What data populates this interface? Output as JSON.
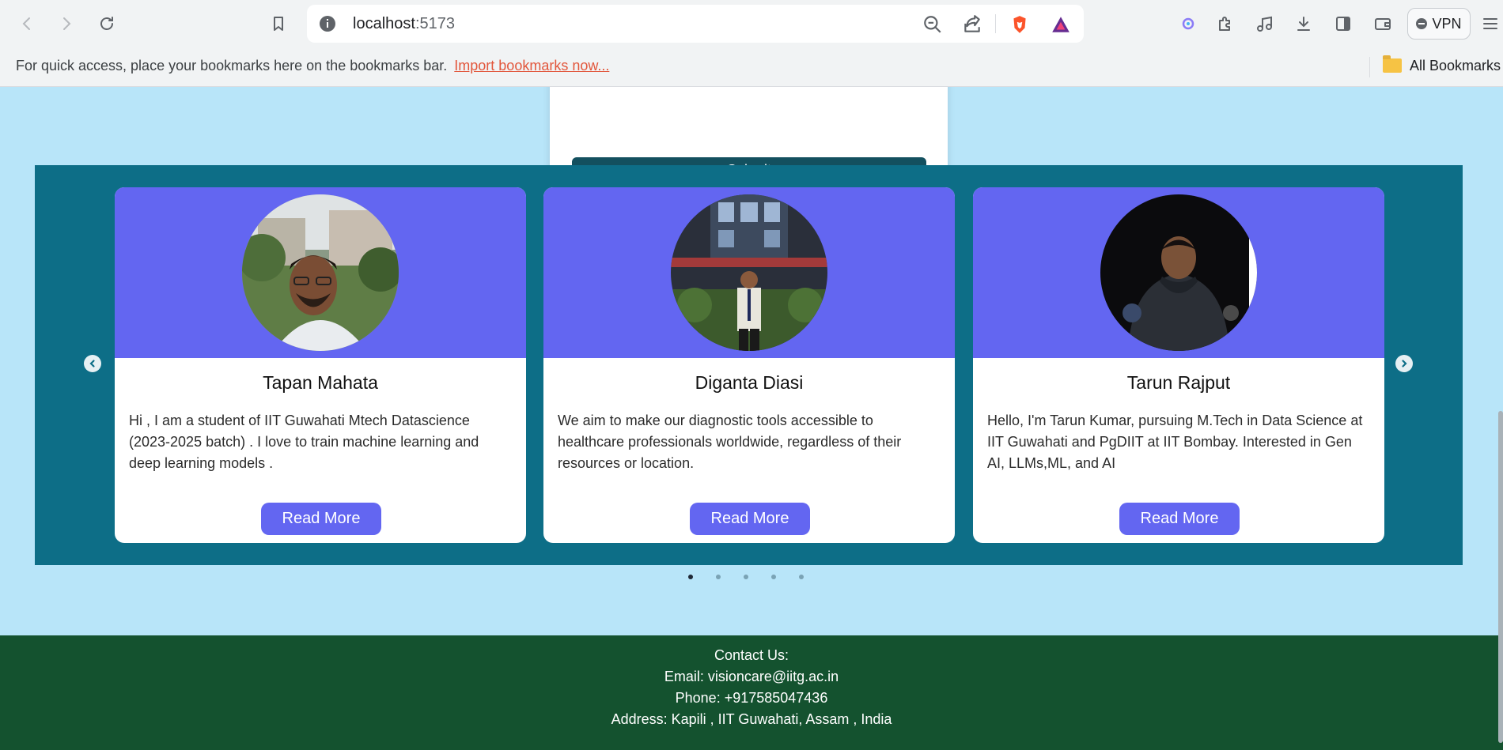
{
  "browser": {
    "url_host": "localhost",
    "url_port": ":5173",
    "vpn_label": "VPN",
    "bookmarks_hint": "For quick access, place your bookmarks here on the bookmarks bar.",
    "bookmarks_import": "Import bookmarks now...",
    "all_bookmarks": "All Bookmarks"
  },
  "form": {
    "submit_label": "Submit"
  },
  "team": [
    {
      "name": "Tapan Mahata",
      "bio": "Hi , I am a student of IIT Guwahati Mtech Datascience (2023-2025 batch) . I love to train machine learning and deep learning models .",
      "button": "Read More"
    },
    {
      "name": "Diganta Diasi",
      "bio": "We aim to make our diagnostic tools accessible to healthcare professionals worldwide, regardless of their resources or location.",
      "button": "Read More"
    },
    {
      "name": "Tarun Rajput",
      "bio": "Hello, I'm Tarun Kumar, pursuing M.Tech in Data Science at IIT Guwahati and PgDIIT at IIT Bombay. Interested in Gen AI, LLMs,ML, and AI",
      "button": "Read More"
    }
  ],
  "carousel": {
    "slide_count": 5,
    "active_index": 0
  },
  "footer": {
    "contact": "Contact Us:",
    "email": "Email: visioncare@iitg.ac.in",
    "phone": "Phone: +917585047436",
    "address": "Address: Kapili , IIT Guwahati, Assam , India"
  },
  "colors": {
    "page_bg": "#b8e5f9",
    "carousel_bg": "#0d6e87",
    "card_accent": "#6366f1",
    "submit_bg": "#13505f",
    "footer_bg": "#14522f",
    "bookmark_link": "#e2563b"
  },
  "icons": [
    "back-icon",
    "forward-icon",
    "reload-icon",
    "bookmark-icon",
    "site-info-icon",
    "zoom-out-icon",
    "share-icon",
    "brave-shield-icon",
    "brave-rewards-icon",
    "leo-ai-icon",
    "extensions-icon",
    "media-icon",
    "download-icon",
    "sidebar-icon",
    "wallet-icon",
    "menu-icon",
    "folder-icon",
    "chevron-left-icon",
    "chevron-right-icon"
  ]
}
